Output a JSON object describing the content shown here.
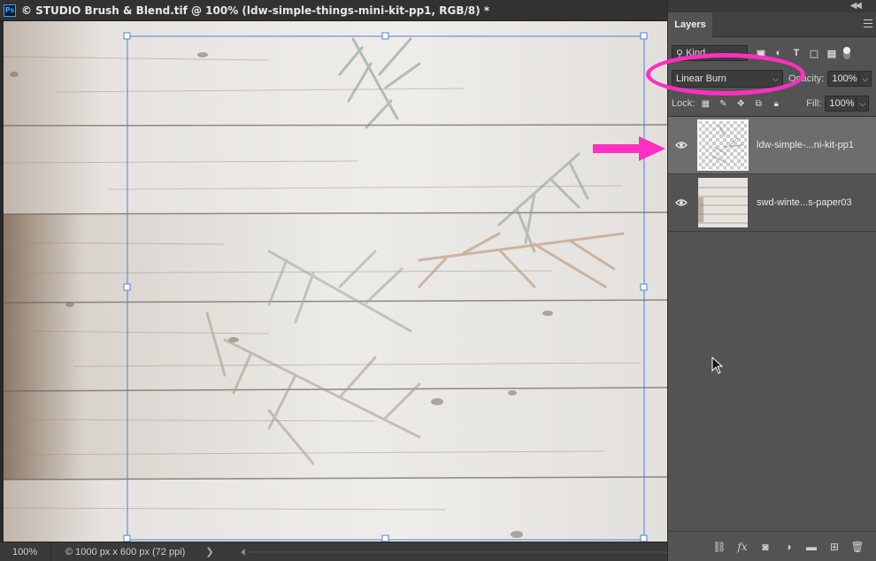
{
  "document": {
    "app_badge": "Ps",
    "title": "© STUDIO Brush & Blend.tif @ 100% (ldw-simple-things-mini-kit-pp1, RGB/8) *"
  },
  "status_bar": {
    "zoom": "100%",
    "doc_info": "© 1000 px x 600 px (72 ppi)",
    "arrow": "❯"
  },
  "layers_panel": {
    "tab_label": "Layers",
    "kind_filter": "Kind",
    "blend_mode": "Linear Burn",
    "opacity_label": "Opacity:",
    "opacity_value": "100%",
    "lock_label": "Lock:",
    "fill_label": "Fill:",
    "fill_value": "100%",
    "layers": [
      {
        "name": "ldw-simple-...ni-kit-pp1",
        "selected": true,
        "visible": true
      },
      {
        "name": "swd-winte...s-paper03",
        "selected": false,
        "visible": true
      }
    ]
  },
  "colors": {
    "highlight": "#ff2fc1",
    "selection_border": "#4a7fe0",
    "panel_bg": "#535353"
  }
}
